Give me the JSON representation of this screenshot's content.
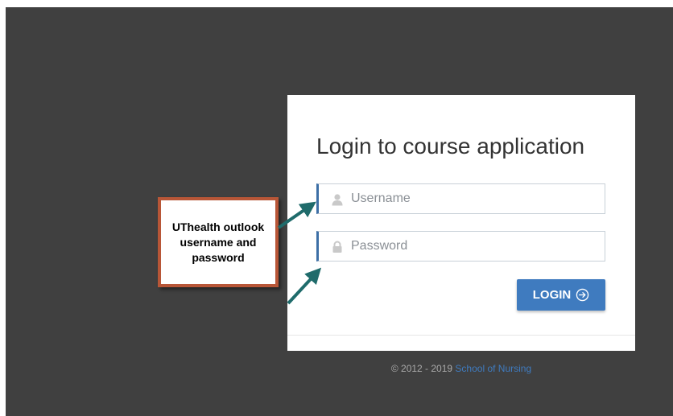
{
  "login": {
    "title": "Login to course application",
    "username_placeholder": "Username",
    "password_placeholder": "Password",
    "button_label": "LOGIN",
    "button_icon": "arrow-circle-right-icon",
    "username_icon": "user-icon",
    "password_icon": "lock-icon"
  },
  "footer": {
    "copyright": "© 2012 - 2019",
    "link_text": "School of Nursing"
  },
  "callout": {
    "text": "UThealth outlook username and password"
  },
  "colors": {
    "backdrop": "#404040",
    "accent": "#3f7bbf",
    "field_border_accent": "#3d6fa6",
    "callout_border": "#b85637",
    "arrow": "#1f6b6b"
  }
}
